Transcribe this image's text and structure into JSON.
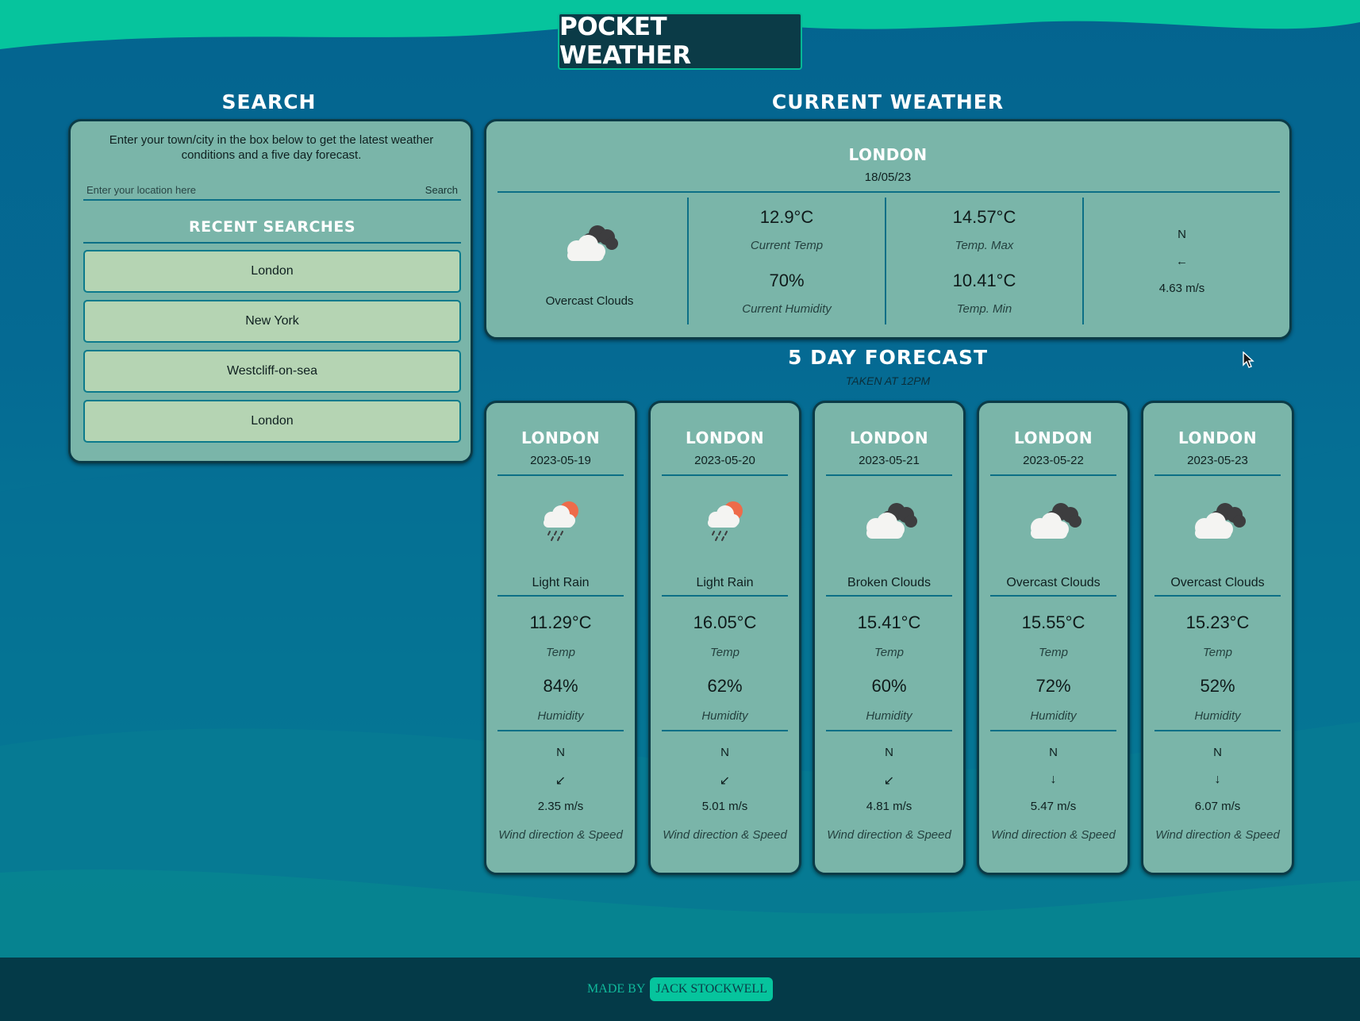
{
  "header": {
    "logo_text": "POCKET WEATHER"
  },
  "search": {
    "section_title": "SEARCH",
    "description": "Enter your town/city in the box below to get the latest weather conditions and a five day forecast.",
    "placeholder": "Enter your location here",
    "button_label": "Search",
    "recent_title": "RECENT SEARCHES",
    "recent": [
      {
        "label": "London"
      },
      {
        "label": "New York"
      },
      {
        "label": "Westcliff-on-sea"
      },
      {
        "label": "London"
      }
    ]
  },
  "current": {
    "section_title": "CURRENT WEATHER",
    "city": "LONDON",
    "date": "18/05/23",
    "icon": "overcast-clouds-icon",
    "description": "Overcast Clouds",
    "temp": "12.9°C",
    "temp_label": "Current Temp",
    "humidity": "70%",
    "humidity_label": "Current Humidity",
    "temp_max": "14.57°C",
    "temp_max_label": "Temp. Max",
    "temp_min": "10.41°C",
    "temp_min_label": "Temp. Min",
    "wind_north": "N",
    "wind_arrow": "←",
    "wind_speed": "4.63 m/s"
  },
  "forecast": {
    "section_title": "5 DAY FORECAST",
    "subtitle": "TAKEN AT 12PM",
    "days": [
      {
        "city": "LONDON",
        "date": "2023-05-19",
        "icon": "light-rain-icon",
        "description": "Light Rain",
        "temp": "11.29°C",
        "temp_label": "Temp",
        "humidity": "84%",
        "humidity_label": "Humidity",
        "wind_north": "N",
        "wind_arrow": "↙",
        "wind_speed": "2.35 m/s",
        "wind_label": "Wind direction & Speed"
      },
      {
        "city": "LONDON",
        "date": "2023-05-20",
        "icon": "light-rain-icon",
        "description": "Light Rain",
        "temp": "16.05°C",
        "temp_label": "Temp",
        "humidity": "62%",
        "humidity_label": "Humidity",
        "wind_north": "N",
        "wind_arrow": "↙",
        "wind_speed": "5.01 m/s",
        "wind_label": "Wind direction & Speed"
      },
      {
        "city": "LONDON",
        "date": "2023-05-21",
        "icon": "broken-clouds-icon",
        "description": "Broken Clouds",
        "temp": "15.41°C",
        "temp_label": "Temp",
        "humidity": "60%",
        "humidity_label": "Humidity",
        "wind_north": "N",
        "wind_arrow": "↙",
        "wind_speed": "4.81 m/s",
        "wind_label": "Wind direction & Speed"
      },
      {
        "city": "LONDON",
        "date": "2023-05-22",
        "icon": "overcast-clouds-icon",
        "description": "Overcast Clouds",
        "temp": "15.55°C",
        "temp_label": "Temp",
        "humidity": "72%",
        "humidity_label": "Humidity",
        "wind_north": "N",
        "wind_arrow": "↓",
        "wind_speed": "5.47 m/s",
        "wind_label": "Wind direction & Speed"
      },
      {
        "city": "LONDON",
        "date": "2023-05-23",
        "icon": "overcast-clouds-icon",
        "description": "Overcast Clouds",
        "temp": "15.23°C",
        "temp_label": "Temp",
        "humidity": "52%",
        "humidity_label": "Humidity",
        "wind_north": "N",
        "wind_arrow": "↓",
        "wind_speed": "6.07 m/s",
        "wind_label": "Wind direction & Speed"
      }
    ]
  },
  "footer": {
    "made_by": "MADE BY",
    "author": "JACK STOCKWELL"
  },
  "colors": {
    "accent": "#06c49d",
    "panel": "#7ab5a9",
    "recent_item": "#b5d4b3",
    "footer": "#043a48",
    "logo_bg": "#0b3b47"
  }
}
